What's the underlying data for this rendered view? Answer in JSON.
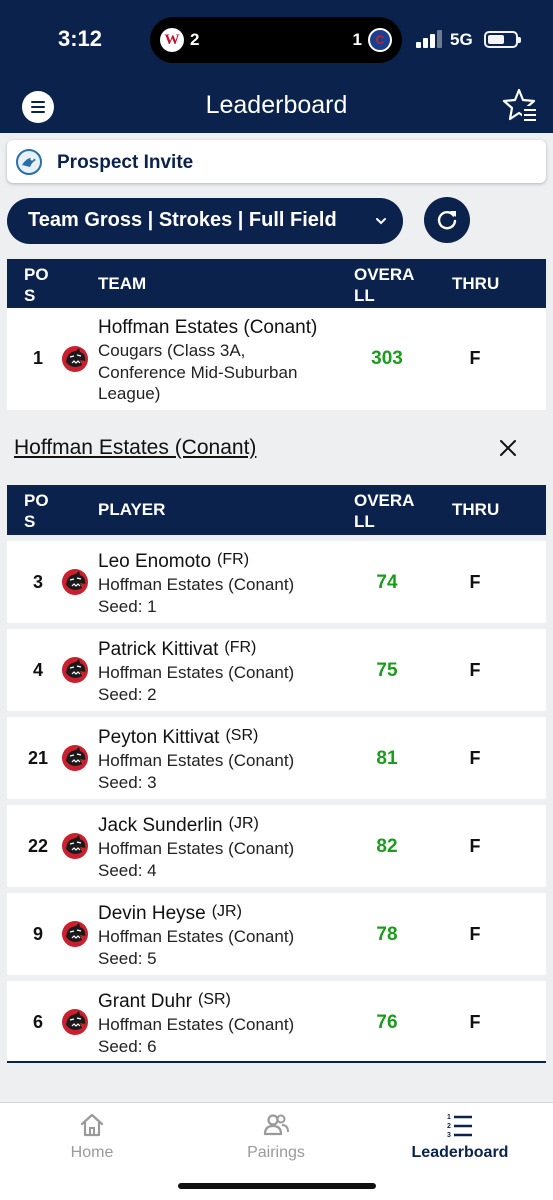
{
  "status_bar": {
    "time": "3:12",
    "live_activity_left_score": "2",
    "live_activity_right_score": "1",
    "network": "5G"
  },
  "nav": {
    "title": "Leaderboard",
    "menu_icon": "hamburger-icon",
    "favorites_icon": "star-list-icon"
  },
  "tournament": {
    "name": "Prospect Invite"
  },
  "filter": {
    "label": "Team Gross | Strokes | Full Field"
  },
  "team_table": {
    "headers": {
      "pos": "POS",
      "name": "TEAM",
      "overall": "OVERALL",
      "thru": "THRU"
    },
    "rows": [
      {
        "pos": "1",
        "name": "Hoffman Estates (Conant)",
        "subtitle": "Cougars (Class 3A, Conference Mid-Suburban League)",
        "subtitle_lines": [
          "Cougars (Class 3A,",
          "Conference Mid-Suburban",
          "League)"
        ],
        "overall": "303",
        "thru": "F"
      }
    ]
  },
  "team_detail": {
    "team_name": "Hoffman Estates (Conant)"
  },
  "player_table": {
    "headers": {
      "pos": "POS",
      "name": "PLAYER",
      "overall": "OVERALL",
      "thru": "THRU"
    },
    "rows": [
      {
        "pos": "3",
        "name": "Leo Enomoto",
        "class": "(FR)",
        "team": "Hoffman Estates (Conant)",
        "seed": "Seed: 1",
        "overall": "74",
        "thru": "F"
      },
      {
        "pos": "4",
        "name": "Patrick Kittivat",
        "class": "(FR)",
        "team": "Hoffman Estates (Conant)",
        "seed": "Seed: 2",
        "overall": "75",
        "thru": "F"
      },
      {
        "pos": "21",
        "name": "Peyton Kittivat",
        "class": "(SR)",
        "team": "Hoffman Estates (Conant)",
        "seed": "Seed: 3",
        "overall": "81",
        "thru": "F"
      },
      {
        "pos": "22",
        "name": "Jack Sunderlin",
        "class": "(JR)",
        "team": "Hoffman Estates (Conant)",
        "seed": "Seed: 4",
        "overall": "82",
        "thru": "F"
      },
      {
        "pos": "9",
        "name": "Devin Heyse",
        "class": "(JR)",
        "team": "Hoffman Estates (Conant)",
        "seed": "Seed: 5",
        "overall": "78",
        "thru": "F"
      },
      {
        "pos": "6",
        "name": "Grant Duhr",
        "class": "(SR)",
        "team": "Hoffman Estates (Conant)",
        "seed": "Seed: 6",
        "overall": "76",
        "thru": "F"
      }
    ]
  },
  "tab_bar": {
    "tabs": [
      {
        "label": "Home",
        "icon": "home-icon",
        "active": false
      },
      {
        "label": "Pairings",
        "icon": "pairings-icon",
        "active": false
      },
      {
        "label": "Leaderboard",
        "icon": "leaderboard-list-icon",
        "active": true
      }
    ]
  },
  "colors": {
    "navy": "#0b234c",
    "score_green": "#1c9c1c",
    "background": "#eeeff1"
  }
}
